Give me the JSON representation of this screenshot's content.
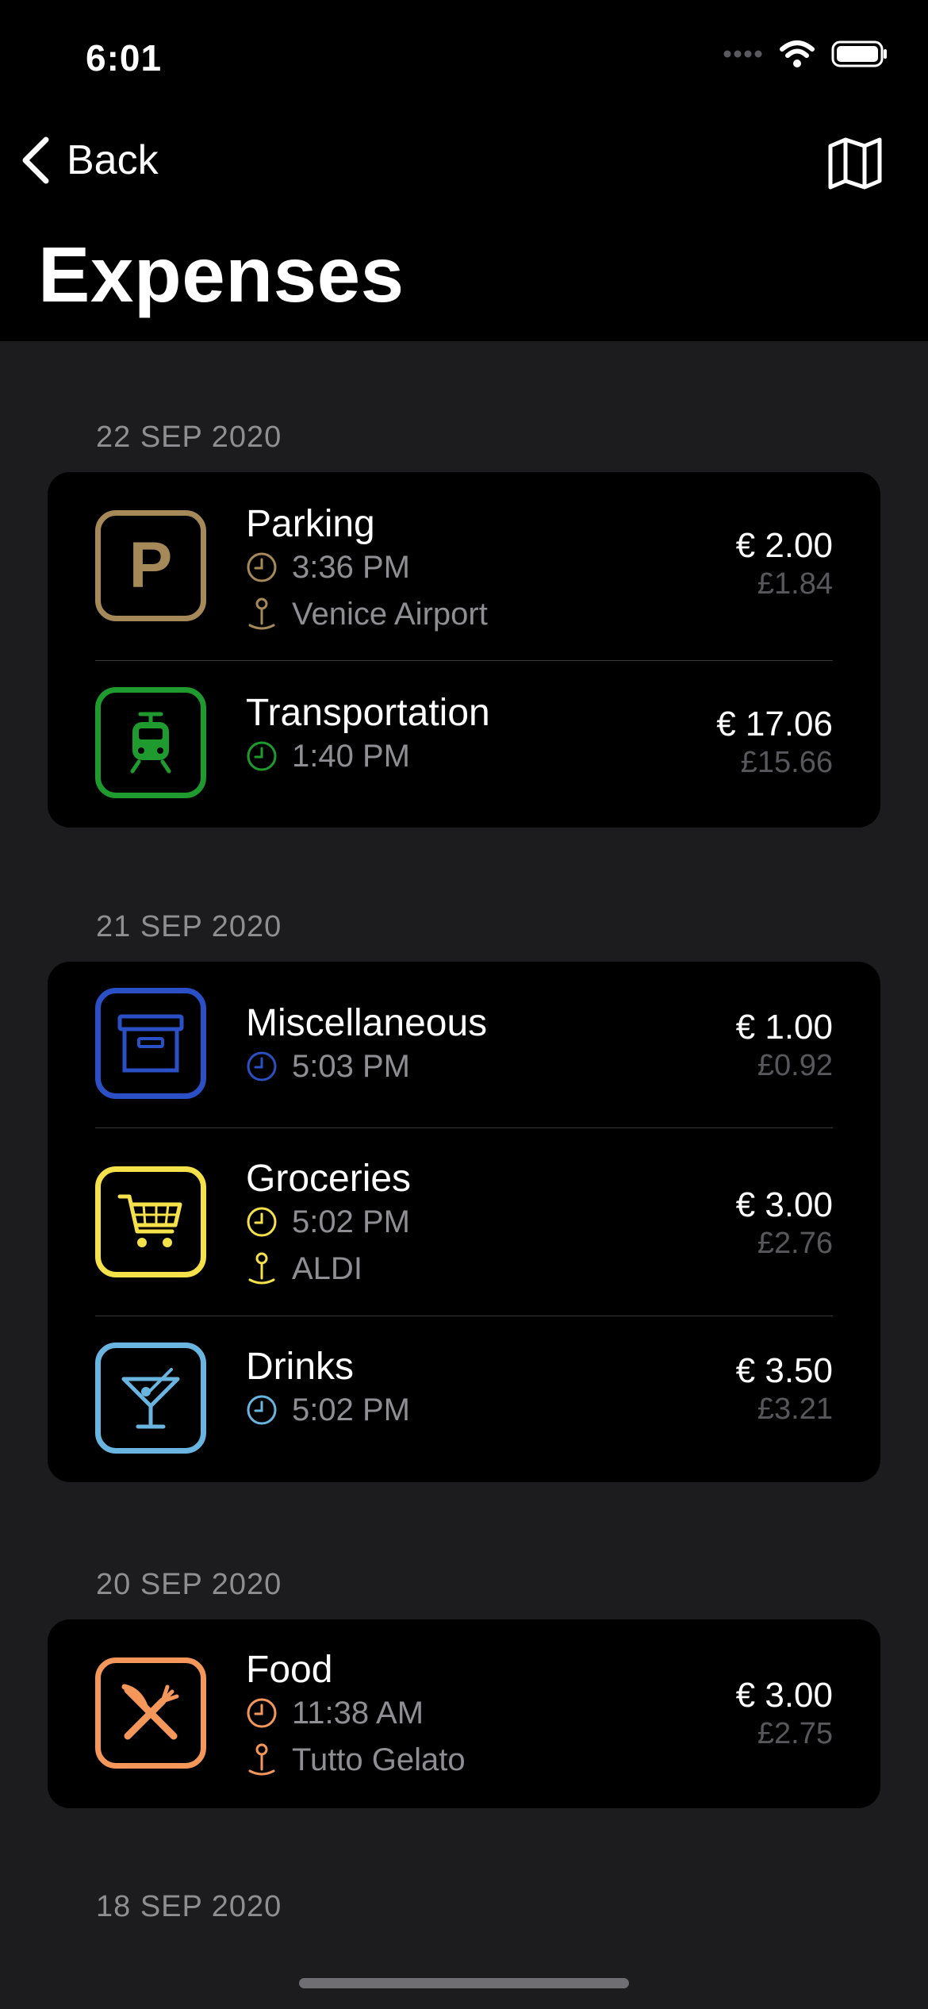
{
  "status": {
    "time": "6:01"
  },
  "nav": {
    "back_label": "Back",
    "title": "Expenses"
  },
  "colors": {
    "parking": "#a68959",
    "transportation": "#1f9a2e",
    "miscellaneous": "#2b4fc4",
    "groceries": "#f5e14a",
    "drinks": "#6ab4e0",
    "food": "#f5975a"
  },
  "sections": [
    {
      "date": "22 SEP 2020",
      "items": [
        {
          "title": "Parking",
          "time": "3:36 PM",
          "location": "Venice Airport",
          "amount": "€ 2.00",
          "converted": "£1.84",
          "icon": "parking-icon"
        },
        {
          "title": "Transportation",
          "time": "1:40 PM",
          "amount": "€ 17.06",
          "converted": "£15.66",
          "icon": "tram-icon"
        }
      ]
    },
    {
      "date": "21 SEP 2020",
      "items": [
        {
          "title": "Miscellaneous",
          "time": "5:03 PM",
          "amount": "€ 1.00",
          "converted": "£0.92",
          "icon": "archive-box-icon"
        },
        {
          "title": "Groceries",
          "time": "5:02 PM",
          "location": "ALDI",
          "amount": "€ 3.00",
          "converted": "£2.76",
          "icon": "cart-icon"
        },
        {
          "title": "Drinks",
          "time": "5:02 PM",
          "amount": "€ 3.50",
          "converted": "£3.21",
          "icon": "cocktail-icon"
        }
      ]
    },
    {
      "date": "20 SEP 2020",
      "items": [
        {
          "title": "Food",
          "time": "11:38 AM",
          "location": "Tutto Gelato",
          "amount": "€ 3.00",
          "converted": "£2.75",
          "icon": "fork-knife-icon"
        }
      ]
    },
    {
      "date": "18 SEP 2020",
      "items": []
    }
  ]
}
